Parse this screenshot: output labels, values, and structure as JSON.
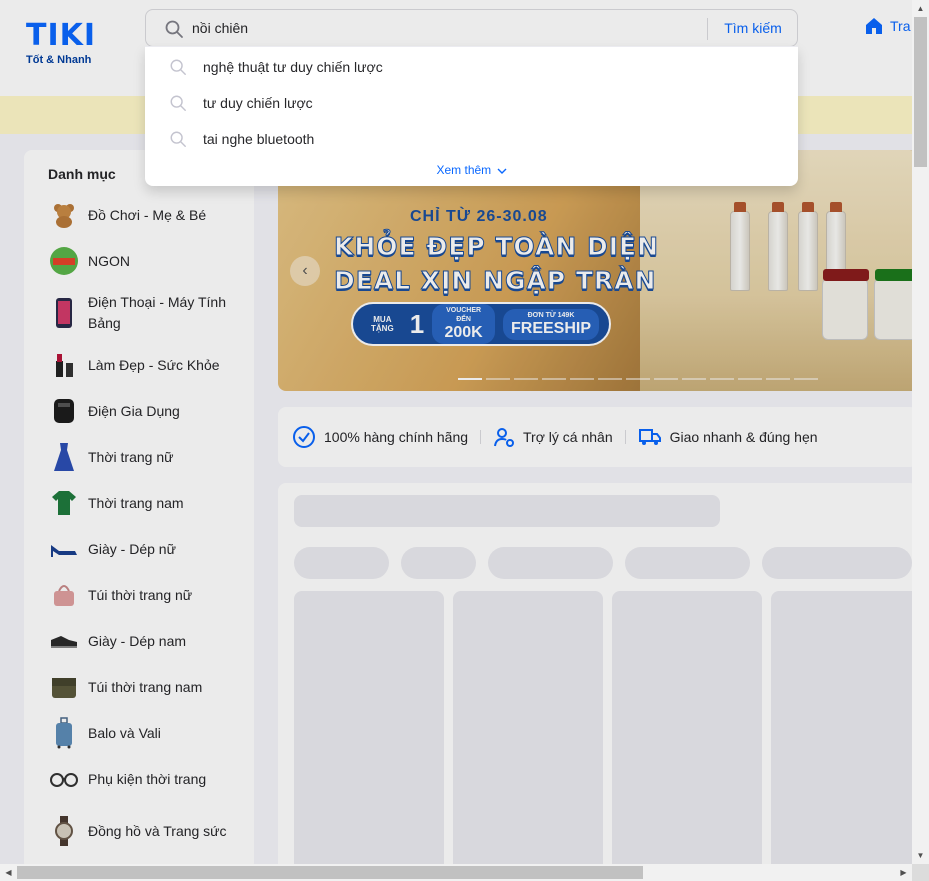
{
  "header": {
    "logo_text": "TIKI",
    "logo_tagline": "Tốt & Nhanh",
    "search_value": "nồi chiên",
    "search_button": "Tìm kiếm",
    "home_label": "Tra"
  },
  "dropdown": {
    "suggestions": [
      "nghệ thuật tư duy chiến lược",
      "tư duy chiến lược",
      "tai nghe bluetooth"
    ],
    "more_label": "Xem thêm"
  },
  "sidebar": {
    "title": "Danh mục",
    "items": [
      {
        "label": "Đồ Chơi - Mẹ & Bé",
        "icon": "teddy-bear-icon"
      },
      {
        "label": "NGON",
        "icon": "ngon-icon"
      },
      {
        "label": "Điện Thoại - Máy Tính Bảng",
        "icon": "phone-icon"
      },
      {
        "label": "Làm Đẹp - Sức Khỏe",
        "icon": "lipstick-icon"
      },
      {
        "label": "Điện Gia Dụng",
        "icon": "appliance-icon"
      },
      {
        "label": "Thời trang nữ",
        "icon": "dress-icon"
      },
      {
        "label": "Thời trang nam",
        "icon": "tshirt-icon"
      },
      {
        "label": "Giày - Dép nữ",
        "icon": "heel-shoe-icon"
      },
      {
        "label": "Túi thời trang nữ",
        "icon": "handbag-icon"
      },
      {
        "label": "Giày - Dép nam",
        "icon": "sneaker-icon"
      },
      {
        "label": "Túi thời trang nam",
        "icon": "messenger-bag-icon"
      },
      {
        "label": "Balo và Vali",
        "icon": "suitcase-icon"
      },
      {
        "label": "Phụ kiện thời trang",
        "icon": "glasses-icon"
      },
      {
        "label": "Đồng hồ và Trang sức",
        "icon": "watch-icon"
      }
    ]
  },
  "banner": {
    "date_line": "CHỈ TỪ 26-30.08",
    "headline1": "KHỎE ĐẸP TOÀN DIỆN",
    "headline2": "DEAL XỊN NGẬP TRÀN",
    "buy_label": "MUA TẶNG",
    "buy_count": "1",
    "voucher_label": "VOUCHER ĐẾN",
    "voucher_value": "200K",
    "freeship_label": "ĐƠN TỪ 149K",
    "freeship_value": "FREESHIP",
    "active_slide": 1,
    "slide_count": 13
  },
  "guarantees": [
    "100% hàng chính hãng",
    "Trợ lý cá nhân",
    "Giao nhanh & đúng hẹn"
  ],
  "colors": {
    "brand_blue": "#0a68ff",
    "promo_strip": "#fff8c9",
    "page_bg": "#f5f5fa"
  }
}
